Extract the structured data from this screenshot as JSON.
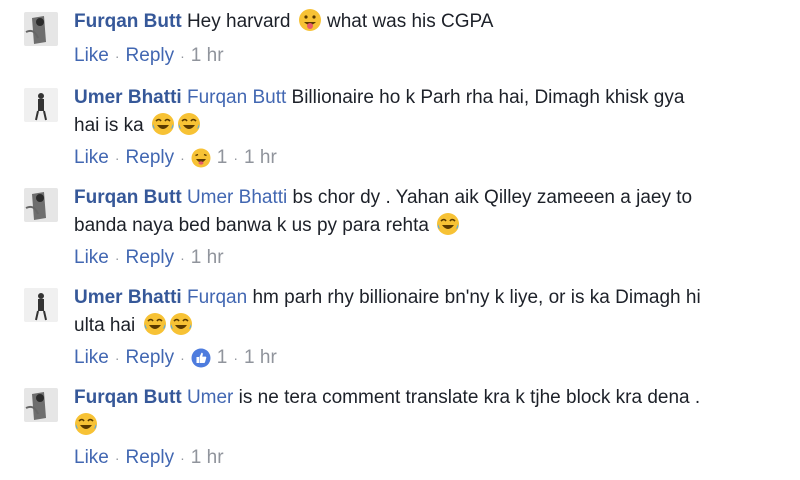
{
  "comments": [
    {
      "author": "Furqan Butt",
      "mention": "",
      "text": "Hey harvard",
      "text2": "what was his CGPA",
      "actions": {
        "like": "Like",
        "reply": "Reply",
        "time": "1 hr",
        "reaction_count": ""
      }
    },
    {
      "author": "Umer Bhatti",
      "mention": "Furqan Butt",
      "text": "Billionaire ho k Parh rha hai, Dimagh khisk gya",
      "text_line2": "hai is ka",
      "actions": {
        "like": "Like",
        "reply": "Reply",
        "time": "1 hr",
        "reaction_count": "1"
      }
    },
    {
      "author": "Furqan Butt",
      "mention": "Umer Bhatti",
      "text": "bs chor dy . Yahan aik Qilley zameeen a jaey to",
      "text_line2": "banda naya bed banwa k us py para rehta",
      "actions": {
        "like": "Like",
        "reply": "Reply",
        "time": "1 hr",
        "reaction_count": ""
      }
    },
    {
      "author": "Umer Bhatti",
      "mention": "Furqan",
      "text": "hm parh rhy billionaire bn'ny k liye, or is ka Dimagh hi",
      "text_line2": "ulta hai",
      "actions": {
        "like": "Like",
        "reply": "Reply",
        "time": "1 hr",
        "reaction_count": "1"
      }
    },
    {
      "author": "Furqan Butt",
      "mention": "Umer",
      "text": "is ne tera comment translate kra k tjhe block kra dena .",
      "actions": {
        "like": "Like",
        "reply": "Reply",
        "time": "1 hr",
        "reaction_count": ""
      }
    }
  ],
  "colors": {
    "author": "#365899",
    "mention": "#4267b2",
    "meta": "#90949c",
    "emoji_yellow": "#f7c235"
  },
  "icons": {
    "tongue_emoji": "face-with-tongue-icon",
    "laugh_emoji": "tears-of-joy-icon",
    "haha_reaction": "haha-reaction-icon",
    "like_reaction": "like-reaction-icon"
  }
}
